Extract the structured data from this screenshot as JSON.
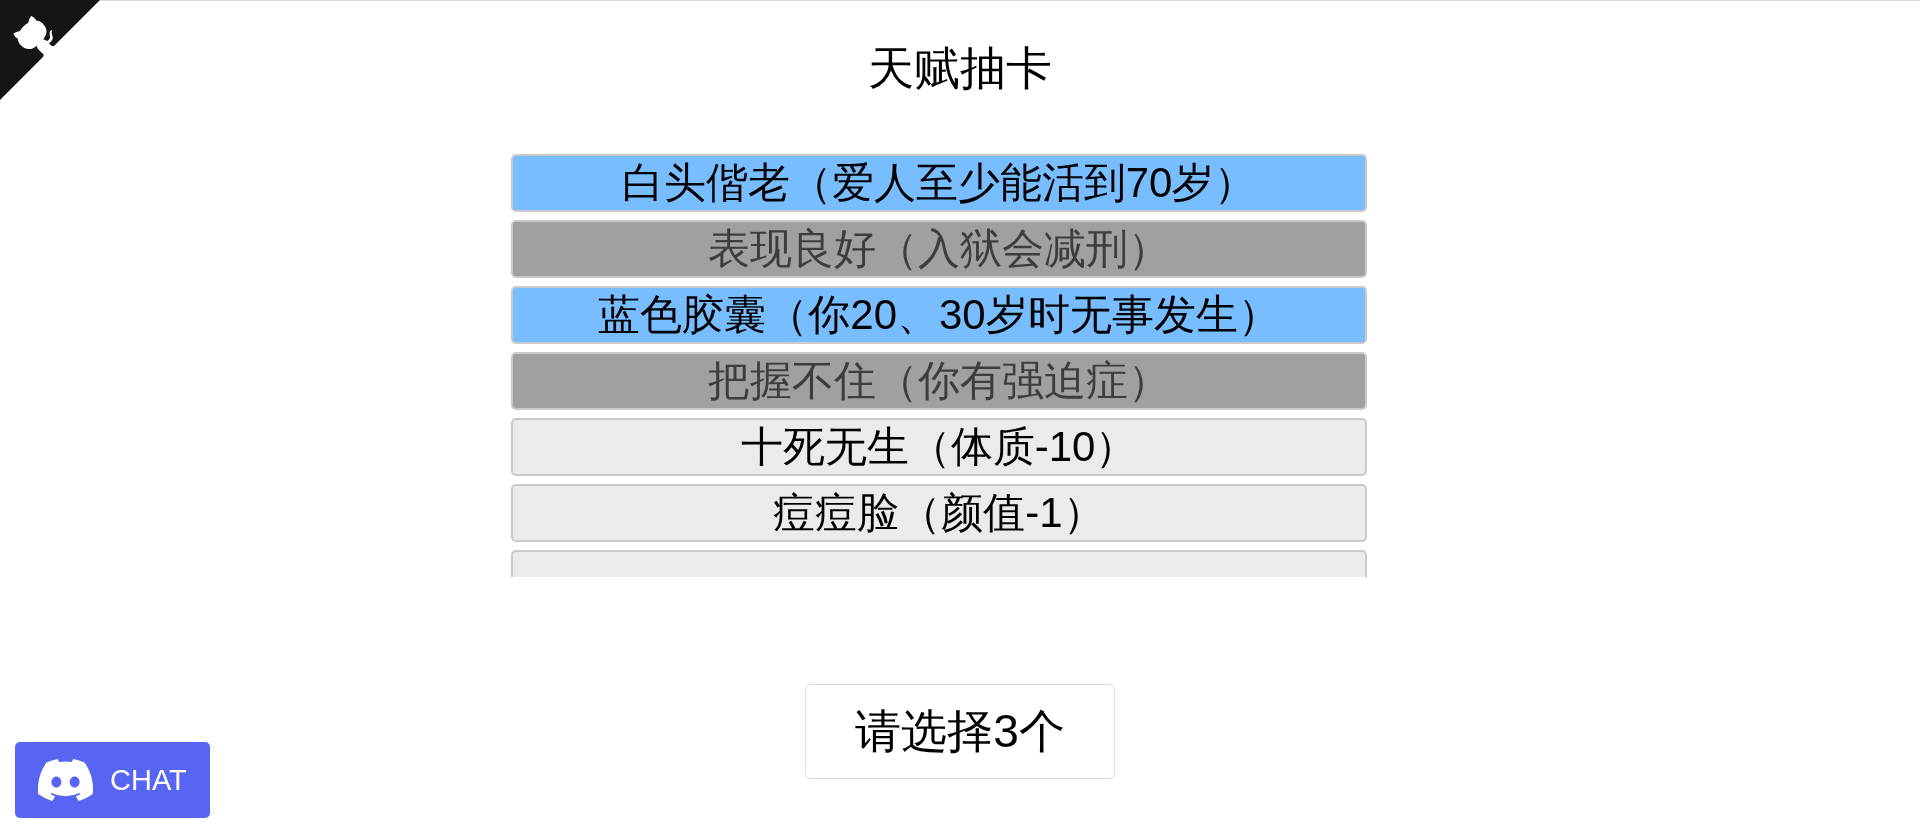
{
  "title": "天赋抽卡",
  "talents": [
    {
      "label": "白头偕老（爱人至少能活到70岁）",
      "color": "#77bdff",
      "selected": false
    },
    {
      "label": "表现良好（入狱会减刑）",
      "selected": true
    },
    {
      "label": "蓝色胶囊（你20、30岁时无事发生）",
      "color": "#77bdff",
      "selected": false
    },
    {
      "label": "把握不住（你有强迫症）",
      "selected": true
    },
    {
      "label": "十死无生（体质-10）",
      "color": "#ebebeb",
      "selected": false
    },
    {
      "label": "痘痘脸（颜值-1）",
      "color": "#ebebeb",
      "selected": false
    },
    {
      "color": "#ebebeb",
      "selected": false
    }
  ],
  "confirm_button": {
    "label": "请选择3个"
  },
  "chat_button": {
    "label": "CHAT"
  }
}
